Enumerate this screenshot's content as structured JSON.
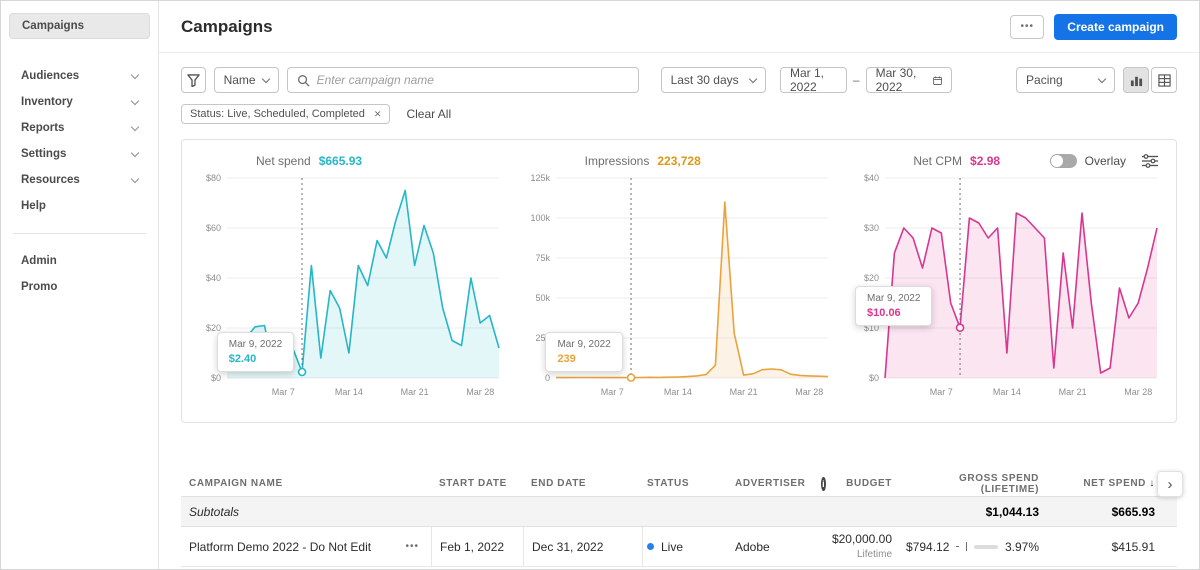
{
  "colors": {
    "accent_blue": "#1473e6",
    "teal": "#26b6c7",
    "orange": "#e8a33d",
    "pink": "#d83790",
    "live_dot": "#2680eb"
  },
  "icons": {
    "more": "•••",
    "row_more": "•••",
    "close": "✕",
    "sort_desc": "↓",
    "scroll_right": "›",
    "info": "i"
  },
  "sidebar": {
    "items": [
      {
        "label": "Campaigns"
      },
      {
        "label": "Audiences"
      },
      {
        "label": "Inventory"
      },
      {
        "label": "Reports"
      },
      {
        "label": "Settings"
      },
      {
        "label": "Resources"
      },
      {
        "label": "Help"
      },
      {
        "label": "Admin"
      },
      {
        "label": "Promo"
      }
    ]
  },
  "header": {
    "title": "Campaigns",
    "create_button": "Create campaign"
  },
  "filters": {
    "field_select": "Name",
    "search_placeholder": "Enter campaign name",
    "date_preset": "Last 30 days",
    "date_start": "Mar 1, 2022",
    "date_separator": "–",
    "date_end": "Mar 30, 2022",
    "metric_select": "Pacing",
    "status_tag": "Status: Live, Scheduled, Completed",
    "clear_all": "Clear All"
  },
  "charts_panel": {
    "overlay_label": "Overlay",
    "charts": [
      {
        "label": "Net spend",
        "value": "$665.93"
      },
      {
        "label": "Impressions",
        "value": "223,728"
      },
      {
        "label": "Net CPM",
        "value": "$2.98"
      }
    ]
  },
  "chart_data": [
    {
      "type": "line",
      "title": "Net spend",
      "total_label": "$665.93",
      "color": "#26b6c7",
      "values": [
        18,
        13,
        16,
        20.5,
        21,
        3,
        14,
        12,
        2.4,
        45,
        8,
        35,
        28,
        10,
        45,
        37,
        55,
        48,
        63,
        75,
        45,
        61,
        50,
        28,
        15,
        13,
        40,
        22,
        25,
        12
      ],
      "ylim": [
        0,
        80
      ],
      "yticks": [
        0,
        20,
        40,
        60,
        80
      ],
      "ytick_labels": [
        "$0",
        "$20",
        "$40",
        "$60",
        "$80"
      ],
      "xtick_labels": [
        "Mar 7",
        "Mar 14",
        "Mar 21",
        "Mar 28"
      ],
      "xtick_indices": [
        6,
        13,
        20,
        27
      ],
      "marker_index": 8,
      "tooltip": {
        "date": "Mar 9, 2022",
        "value": "$2.40"
      },
      "tooltip_pos": {
        "left": 0.08,
        "top": 0.7
      },
      "grid": true,
      "legend": "none"
    },
    {
      "type": "line",
      "title": "Impressions",
      "total_label": "223,728",
      "color": "#e8a33d",
      "values": [
        320,
        280,
        300,
        310,
        290,
        260,
        270,
        255,
        239,
        310,
        420,
        380,
        520,
        640,
        900,
        1300,
        2200,
        8000,
        110000,
        28000,
        1800,
        2600,
        5200,
        5600,
        5100,
        2400,
        1600,
        1300,
        1100,
        950
      ],
      "ylim": [
        0,
        125000
      ],
      "yticks": [
        0,
        25000,
        50000,
        75000,
        100000,
        125000
      ],
      "ytick_labels": [
        "0",
        "25k",
        "50k",
        "75k",
        "100k",
        "125k"
      ],
      "xtick_labels": [
        "Mar 7",
        "Mar 14",
        "Mar 21",
        "Mar 28"
      ],
      "xtick_indices": [
        6,
        13,
        20,
        27
      ],
      "marker_index": 8,
      "tooltip": {
        "date": "Mar 9, 2022",
        "value": "239"
      },
      "tooltip_pos": {
        "left": 0.08,
        "top": 0.7
      },
      "grid": true,
      "legend": "none"
    },
    {
      "type": "line",
      "title": "Net CPM",
      "total_label": "$2.98",
      "color": "#d83790",
      "values": [
        0,
        25,
        30,
        28,
        22,
        30,
        29,
        15,
        10.06,
        32,
        31,
        28,
        30,
        5,
        33,
        32,
        30,
        28,
        2,
        25,
        10,
        33,
        15,
        1,
        2,
        18,
        12,
        15,
        22,
        30
      ],
      "ylim": [
        0,
        40
      ],
      "yticks": [
        0,
        10,
        20,
        30,
        40
      ],
      "ytick_labels": [
        "$0",
        "$10",
        "$20",
        "$30",
        "$40"
      ],
      "xtick_labels": [
        "Mar 7",
        "Mar 14",
        "Mar 21",
        "Mar 28"
      ],
      "xtick_indices": [
        6,
        13,
        20,
        27
      ],
      "marker_index": 8,
      "tooltip": {
        "date": "Mar 9, 2022",
        "value": "$10.06"
      },
      "tooltip_pos": {
        "left": 0.02,
        "top": 0.5
      },
      "grid": true,
      "legend": "none"
    }
  ],
  "table": {
    "headers": [
      "CAMPAIGN NAME",
      "START DATE",
      "END DATE",
      "STATUS",
      "ADVERTISER",
      "BUDGET",
      "GROSS SPEND (LIFETIME)",
      "NET SPEND"
    ],
    "subtotals": {
      "label": "Subtotals",
      "gross_spend": "$1,044.13",
      "net_spend": "$665.93"
    },
    "rows": [
      {
        "name": "Platform Demo 2022 - Do Not Edit",
        "start_date": "Feb 1, 2022",
        "end_date": "Dec 31, 2022",
        "status": "Live",
        "advertiser": "Adobe",
        "budget": "$20,000.00",
        "budget_type": "Lifetime",
        "gross_spend": "$794.12",
        "pacing_pct": "3.97%",
        "net_spend": "$415.91"
      }
    ]
  }
}
